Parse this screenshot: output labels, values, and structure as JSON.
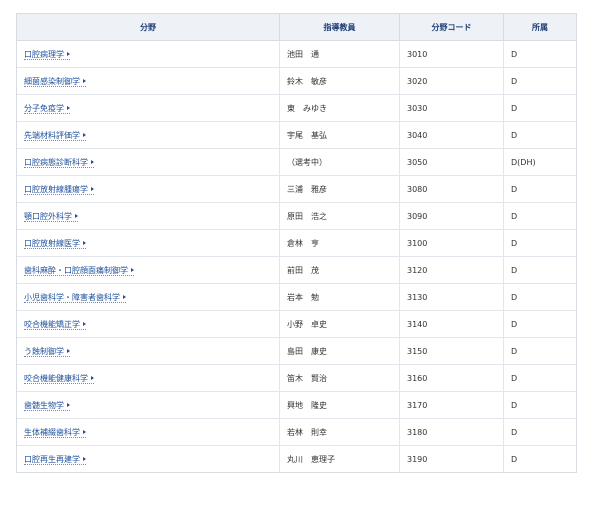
{
  "table": {
    "headers": [
      "分野",
      "指導教員",
      "分野コード",
      "所属"
    ],
    "rows": [
      {
        "field": "口腔病理学",
        "advisor": "池田　通",
        "code": "3010",
        "affiliation": "D"
      },
      {
        "field": "細菌感染制御学",
        "advisor": "鈴木　敏彦",
        "code": "3020",
        "affiliation": "D"
      },
      {
        "field": "分子免疫学",
        "advisor": "東　みゆき",
        "code": "3030",
        "affiliation": "D"
      },
      {
        "field": "先端材料評価学",
        "advisor": "宇尾　基弘",
        "code": "3040",
        "affiliation": "D"
      },
      {
        "field": "口腔病態診断科学",
        "advisor": "（選考中）",
        "code": "3050",
        "affiliation": "D(DH)"
      },
      {
        "field": "口腔放射線腫瘍学",
        "advisor": "三浦　雅彦",
        "code": "3080",
        "affiliation": "D"
      },
      {
        "field": "顎口腔外科学",
        "advisor": "原田　浩之",
        "code": "3090",
        "affiliation": "D"
      },
      {
        "field": "口腔放射線医学",
        "advisor": "倉林　亨",
        "code": "3100",
        "affiliation": "D"
      },
      {
        "field": "歯科麻酔・口腔顔面痛制御学",
        "advisor": "前田　茂",
        "code": "3120",
        "affiliation": "D"
      },
      {
        "field": "小児歯科学・障害者歯科学",
        "advisor": "岩本　勉",
        "code": "3130",
        "affiliation": "D"
      },
      {
        "field": "咬合機能矯正学",
        "advisor": "小野　卓史",
        "code": "3140",
        "affiliation": "D"
      },
      {
        "field": "う蝕制御学",
        "advisor": "島田　康史",
        "code": "3150",
        "affiliation": "D"
      },
      {
        "field": "咬合機能健康科学",
        "advisor": "笛木　賢治",
        "code": "3160",
        "affiliation": "D"
      },
      {
        "field": "歯髄生物学",
        "advisor": "興地　隆史",
        "code": "3170",
        "affiliation": "D"
      },
      {
        "field": "生体補綴歯科学",
        "advisor": "若林　則幸",
        "code": "3180",
        "affiliation": "D"
      },
      {
        "field": "口腔再生再建学",
        "advisor": "丸川　恵理子",
        "code": "3190",
        "affiliation": "D"
      }
    ]
  },
  "colors": {
    "link": "#1c4f9c",
    "header_text": "#1f3f7a",
    "header_bg": "#eef1f5",
    "border": "#d7dce3"
  },
  "icons": {
    "link_marker": "arrow-right-icon"
  }
}
